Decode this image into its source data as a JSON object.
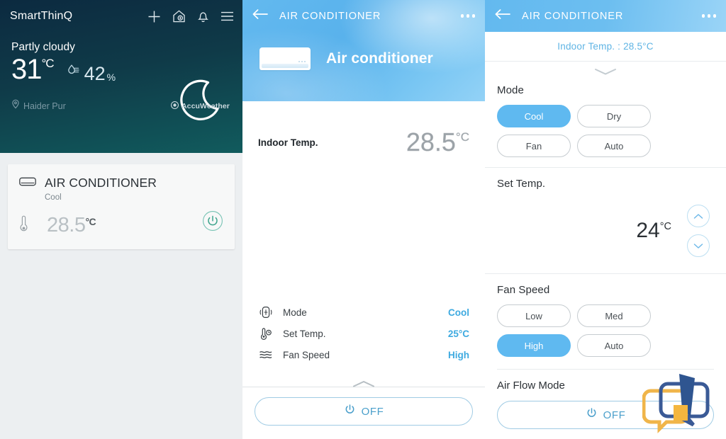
{
  "panel_home": {
    "brand": "SmartThinQ",
    "icons": [
      "plus-icon",
      "home-hand-icon",
      "bell-icon",
      "menu-icon"
    ],
    "weather": {
      "condition": "Partly cloudy",
      "temperature": "31",
      "temperature_unit": "°C",
      "humidity_value": "42",
      "humidity_unit": "%",
      "location": "Haider Pur",
      "provider": "AccuWeather",
      "icon": "moon-icon"
    },
    "device_card": {
      "icon": "air-conditioner-icon",
      "title": "AIR CONDITIONER",
      "subtitle": "Cool",
      "temperature": "28.5",
      "temperature_unit": "°C",
      "power_icon": "power-icon"
    }
  },
  "panel_detail": {
    "header": {
      "back_icon": "arrow-left-icon",
      "title": "AIR CONDITIONER",
      "menu_icon": "more-dots-icon"
    },
    "device_name": "Air conditioner",
    "indoor": {
      "label": "Indoor Temp.",
      "value": "28.5",
      "unit": "°C"
    },
    "settings": [
      {
        "icon": "mode-icon",
        "label": "Mode",
        "value": "Cool"
      },
      {
        "icon": "thermometer-icon",
        "label": "Set Temp.",
        "value": "25°C"
      },
      {
        "icon": "fan-speed-icon",
        "label": "Fan Speed",
        "value": "High"
      }
    ],
    "power_button": {
      "label": "OFF",
      "icon": "power-icon"
    },
    "handle_icon": "chevron-up-icon"
  },
  "panel_controls": {
    "header": {
      "back_icon": "arrow-left-icon",
      "title": "AIR CONDITIONER",
      "menu_icon": "more-dots-icon"
    },
    "indoor_summary": "Indoor Temp. : 28.5°C",
    "collapse_icon": "chevron-down-icon",
    "mode": {
      "title": "Mode",
      "options": [
        "Cool",
        "Dry",
        "Fan",
        "Auto"
      ],
      "selected": "Cool"
    },
    "set_temp": {
      "title": "Set Temp.",
      "value": "24",
      "unit": "°C",
      "up_icon": "chevron-up-icon",
      "down_icon": "chevron-down-icon"
    },
    "fan_speed": {
      "title": "Fan Speed",
      "options": [
        "Low",
        "Med",
        "High",
        "Auto"
      ],
      "selected": "High"
    },
    "air_flow": {
      "title": "Air Flow Mode"
    },
    "power_button": {
      "label": "OFF",
      "icon": "power-icon"
    }
  },
  "colors": {
    "accent_blue": "#5fb9f0",
    "link_blue": "#3eaae0",
    "hero_dark_top": "#0c2a40",
    "hero_dark_bottom": "#115b5d"
  }
}
